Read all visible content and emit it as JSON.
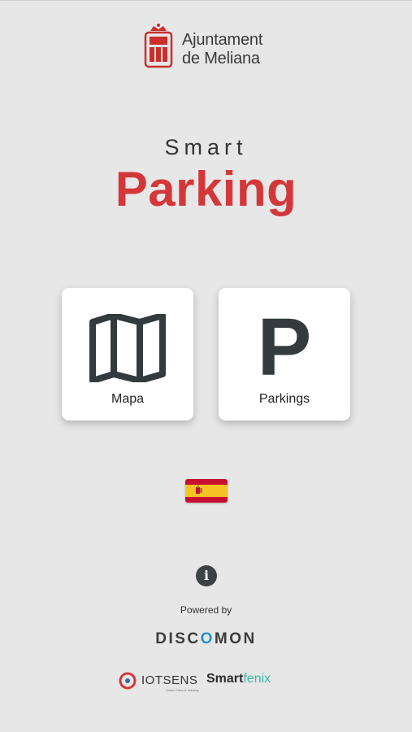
{
  "header": {
    "council_name_line1": "Ajuntament",
    "council_name_line2": "de Meliana"
  },
  "title": {
    "small": "Smart",
    "large": "Parking"
  },
  "tiles": [
    {
      "label": "Mapa",
      "icon": "map-icon"
    },
    {
      "label": "Parkings",
      "icon": "parking-icon",
      "glyph": "P"
    }
  ],
  "language": {
    "current": "es",
    "icon": "spain-flag-icon"
  },
  "info": {
    "icon": "info-icon",
    "glyph": "i"
  },
  "footer": {
    "powered_by": "Powered by",
    "discomon": {
      "part1": "DISC",
      "mark": "O",
      "part2": "MON"
    },
    "iotsens": {
      "name": "IOTSENS",
      "sub": "Smart Cities & Industry"
    },
    "smartfenix": {
      "part1": "Smart",
      "part2": "fenix"
    }
  },
  "colors": {
    "brand_red": "#d4373a",
    "icon_dark": "#333b3e",
    "background": "#e7e7e7"
  }
}
